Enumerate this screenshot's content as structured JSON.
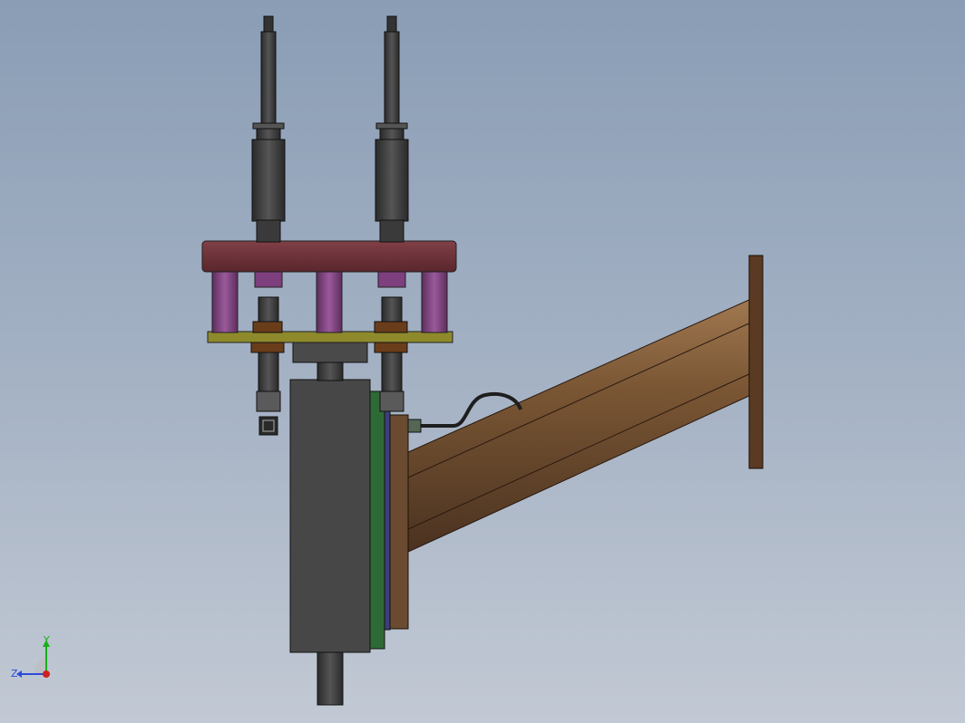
{
  "viewport": {
    "background_top": "#8a9db5",
    "background_bottom": "#c2c9d4"
  },
  "model": {
    "part_colors": {
      "actuator_rod": "#3b3b3b",
      "actuator_body": "#444444",
      "top_plate": "#6e3238",
      "support_columns": "#7d3f7d",
      "base_plate": "#8e8a2c",
      "nuts": "#6a3d1a",
      "center_block": "#4a4a4a",
      "side_panel": "#2e6a36",
      "back_panel": "#3c3f7a",
      "flange_plate": "#6a4a30",
      "beam": "#6b4a2e",
      "end_plate": "#5a3a22",
      "cable": "#1e1e1e"
    }
  },
  "triad": {
    "y_label": "Y",
    "z_label": "Z",
    "y_color": "#18b018",
    "z_color": "#2c4cd8",
    "x_color": "#d02020"
  }
}
